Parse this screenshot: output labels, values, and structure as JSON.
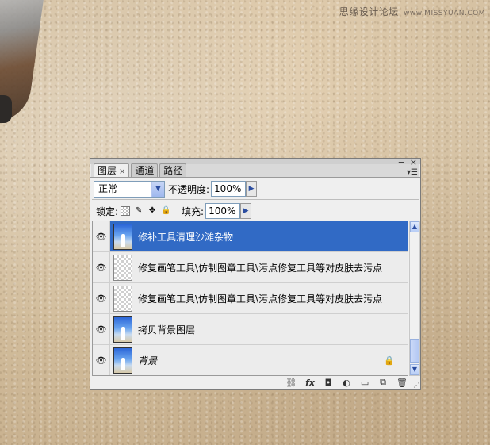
{
  "watermark": {
    "text": "思缘设计论坛",
    "url": "www.MISSYUAN.COM"
  },
  "panel": {
    "tabs": [
      {
        "label": "图层",
        "close": "×"
      },
      {
        "label": "通道"
      },
      {
        "label": "路径"
      }
    ],
    "window_buttons": [
      "−",
      "×"
    ],
    "menu_icon": "panel-menu-icon",
    "blend_mode": "正常",
    "opacity_label": "不透明度:",
    "opacity_value": "100%",
    "lock_label": "锁定:",
    "fill_label": "填充:",
    "fill_value": "100%",
    "layers": [
      {
        "name": "修补工具清理沙滩杂物",
        "selected": true,
        "thumb": "photo"
      },
      {
        "name": "修复画笔工具\\仿制图章工具\\污点修复工具等对皮肤去污点",
        "selected": false,
        "thumb": "transparent"
      },
      {
        "name": "修复画笔工具\\仿制图章工具\\污点修复工具等对皮肤去污点",
        "selected": false,
        "thumb": "transparent"
      },
      {
        "name": "拷贝背景图层",
        "selected": false,
        "thumb": "photo"
      },
      {
        "name": "背景",
        "selected": false,
        "thumb": "photo",
        "locked": true
      }
    ],
    "footer_icons": [
      "link-layers-icon",
      "fx-icon",
      "add-mask-icon",
      "adjustment-layer-icon",
      "new-group-icon",
      "new-layer-icon",
      "delete-layer-icon"
    ],
    "footer_glyphs": [
      "⛓",
      "fx",
      "◘",
      "◐",
      "▭",
      "⧉",
      "🗑"
    ],
    "colors": {
      "selection": "#316ac5",
      "panel_bg": "#efefef"
    }
  }
}
